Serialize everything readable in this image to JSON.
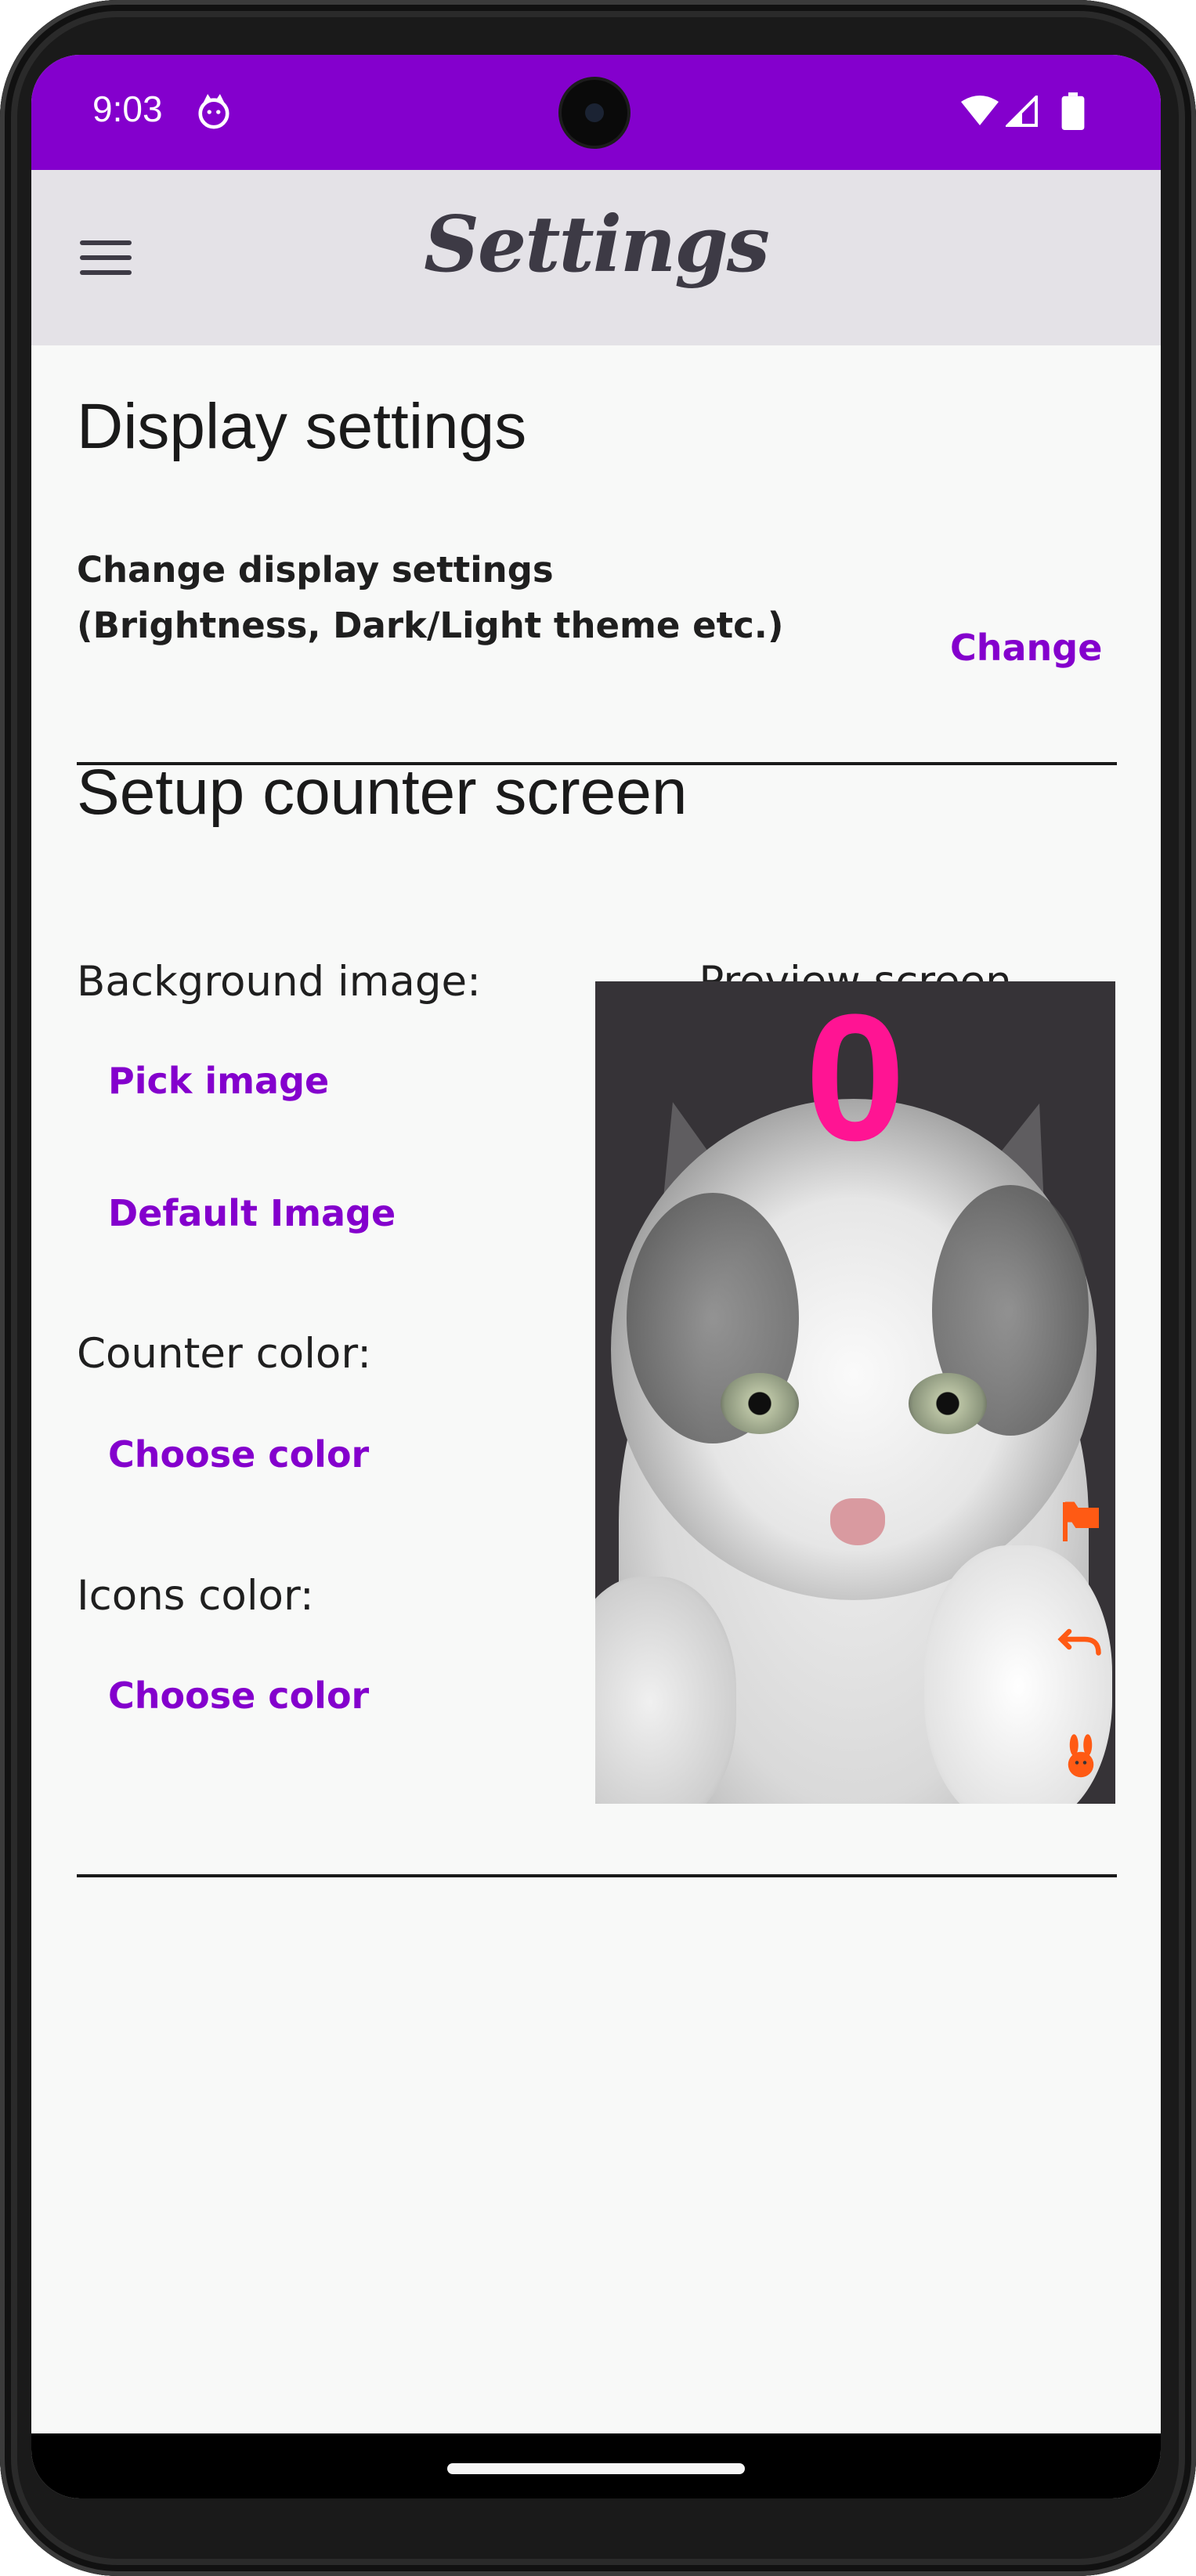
{
  "status_bar": {
    "time": "9:03",
    "background_color": "#8400cd",
    "icons": [
      "app-notification-icon",
      "wifi-icon",
      "cellular-signal-icon",
      "battery-icon"
    ]
  },
  "app_bar": {
    "title": "Settings",
    "menu_icon": "hamburger-menu-icon"
  },
  "display_settings": {
    "title": "Display settings",
    "description": "Change display settings (Brightness, Dark/Light theme etc.)",
    "change_button": "Change"
  },
  "counter_screen": {
    "title": "Setup counter screen",
    "background_image_label": "Background image:",
    "pick_image_button": "Pick image",
    "default_image_button": "Default Image",
    "counter_color_label": "Counter color:",
    "counter_choose_color_button": "Choose color",
    "icons_color_label": "Icons color:",
    "icons_choose_color_button": "Choose color",
    "preview_label": "Preview screen",
    "preview": {
      "counter_value": "0",
      "counter_color": "#ff1493",
      "icons_color": "#ff5a14",
      "icons": [
        "flag-icon",
        "undo-icon",
        "rabbit-icon"
      ],
      "background": "cat photo"
    }
  },
  "colors": {
    "accent": "#8400cd",
    "app_bar_bg": "#e4e2e7",
    "page_bg": "#f8f9f8"
  }
}
